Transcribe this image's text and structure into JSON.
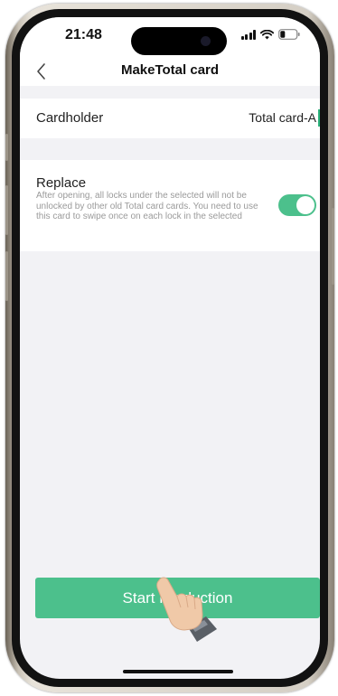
{
  "status_bar": {
    "time": "21:48"
  },
  "nav": {
    "title": "MakeTotal card"
  },
  "cardholder": {
    "label": "Cardholder",
    "value": "Total card-A"
  },
  "replace": {
    "title": "Replace",
    "description": "After opening, all locks under the selected  will not be unlocked by other old Total card cards. You need to use this card to swipe once on each lock in the selected",
    "enabled": true
  },
  "actions": {
    "start_label": "Start Production"
  },
  "colors": {
    "accent": "#4cc08c",
    "background": "#f2f2f5",
    "text": "#222222",
    "secondary_text": "#9a9a9a"
  }
}
